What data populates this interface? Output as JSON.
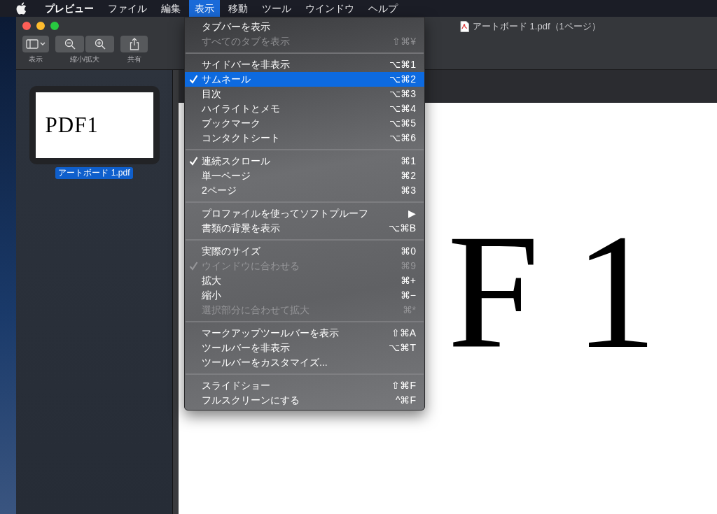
{
  "menu_bar": {
    "items": [
      {
        "label": "プレビュー",
        "kind": "app",
        "selected": false
      },
      {
        "label": "ファイル",
        "kind": "menu",
        "selected": false
      },
      {
        "label": "編集",
        "kind": "menu",
        "selected": false
      },
      {
        "label": "表示",
        "kind": "menu",
        "selected": true
      },
      {
        "label": "移動",
        "kind": "menu",
        "selected": false
      },
      {
        "label": "ツール",
        "kind": "menu",
        "selected": false
      },
      {
        "label": "ウインドウ",
        "kind": "menu",
        "selected": false
      },
      {
        "label": "ヘルプ",
        "kind": "menu",
        "selected": false
      }
    ]
  },
  "window": {
    "title": "アートボード 1.pdf（1ページ）",
    "toolbar": [
      {
        "label": "表示",
        "kind": "sidebar"
      },
      {
        "label": "縮小/拡大",
        "kind": "zoom"
      },
      {
        "label": "共有",
        "kind": "share"
      }
    ],
    "sidebar": {
      "thumbnails": [
        {
          "page_text": "PDF1",
          "label": "アートボード 1.pdf",
          "selected": true
        }
      ]
    },
    "document": {
      "visible_text": "F1"
    }
  },
  "menu": {
    "sections": [
      [
        {
          "label": "タブバーを表示",
          "checked": false,
          "disabled": false,
          "selected": false
        },
        {
          "label": "すべてのタブを表示",
          "shortcut": "⇧⌘¥",
          "checked": false,
          "disabled": true,
          "selected": false
        }
      ],
      [
        {
          "label": "サイドバーを非表示",
          "shortcut": "⌥⌘1",
          "checked": false,
          "disabled": false,
          "selected": false
        },
        {
          "label": "サムネール",
          "shortcut": "⌥⌘2",
          "checked": true,
          "disabled": false,
          "selected": true
        },
        {
          "label": "目次",
          "shortcut": "⌥⌘3",
          "checked": false,
          "disabled": false,
          "selected": false
        },
        {
          "label": "ハイライトとメモ",
          "shortcut": "⌥⌘4",
          "checked": false,
          "disabled": false,
          "selected": false
        },
        {
          "label": "ブックマーク",
          "shortcut": "⌥⌘5",
          "checked": false,
          "disabled": false,
          "selected": false
        },
        {
          "label": "コンタクトシート",
          "shortcut": "⌥⌘6",
          "checked": false,
          "disabled": false,
          "selected": false
        }
      ],
      [
        {
          "label": "連続スクロール",
          "shortcut": "⌘1",
          "checked": true,
          "disabled": false,
          "selected": false
        },
        {
          "label": "単一ページ",
          "shortcut": "⌘2",
          "checked": false,
          "disabled": false,
          "selected": false
        },
        {
          "label": "2ページ",
          "shortcut": "⌘3",
          "checked": false,
          "disabled": false,
          "selected": false
        }
      ],
      [
        {
          "label": "プロファイルを使ってソフトプルーフ",
          "shortcut": "▶",
          "checked": false,
          "disabled": false,
          "selected": false
        },
        {
          "label": "書類の背景を表示",
          "shortcut": "⌥⌘B",
          "checked": false,
          "disabled": false,
          "selected": false
        }
      ],
      [
        {
          "label": "実際のサイズ",
          "shortcut": "⌘0",
          "checked": false,
          "disabled": false,
          "selected": false
        },
        {
          "label": "ウインドウに合わせる",
          "shortcut": "⌘9",
          "checked": true,
          "disabled": true,
          "selected": false
        },
        {
          "label": "拡大",
          "shortcut": "⌘+",
          "checked": false,
          "disabled": false,
          "selected": false
        },
        {
          "label": "縮小",
          "shortcut": "⌘−",
          "checked": false,
          "disabled": false,
          "selected": false
        },
        {
          "label": "選択部分に合わせて拡大",
          "shortcut": "⌘*",
          "checked": false,
          "disabled": true,
          "selected": false
        }
      ],
      [
        {
          "label": "マークアップツールバーを表示",
          "shortcut": "⇧⌘A",
          "checked": false,
          "disabled": false,
          "selected": false
        },
        {
          "label": "ツールバーを非表示",
          "shortcut": "⌥⌘T",
          "checked": false,
          "disabled": false,
          "selected": false
        },
        {
          "label": "ツールバーをカスタマイズ...",
          "checked": false,
          "disabled": false,
          "selected": false
        }
      ],
      [
        {
          "label": "スライドショー",
          "shortcut": "⇧⌘F",
          "checked": false,
          "disabled": false,
          "selected": false
        },
        {
          "label": "フルスクリーンにする",
          "shortcut": "^⌘F",
          "checked": false,
          "disabled": false,
          "selected": false
        }
      ]
    ]
  }
}
